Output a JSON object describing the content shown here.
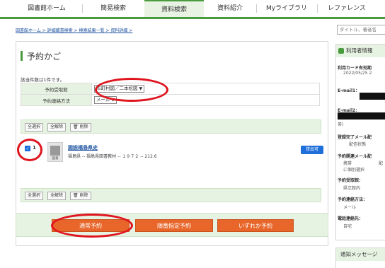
{
  "nav": {
    "tabs": [
      {
        "label": "図書館ホーム"
      },
      {
        "label": "簡易検索"
      },
      {
        "label": "資料検索"
      },
      {
        "label": "資料紹介"
      },
      {
        "label": "Myライブラリ"
      },
      {
        "label": "レファレンス"
      }
    ]
  },
  "breadcrumb": "図書館ホーム > 詳細蔵書検索 > 検索結果一覧 > 資料詳細 >",
  "search": {
    "placeholder": "タイトル、著者名"
  },
  "cart": {
    "title": "予約かご",
    "count_text": "該当件数は1件です。",
    "pickup_label": "予約受取館",
    "pickup_value": "市町村図／二本松図",
    "contact_label": "予約連絡方法",
    "contact_value": "メール",
    "select_all": "全選択",
    "deselect_all": "全解除",
    "delete": "削除",
    "item": {
      "number": "1",
      "title": "図説福島県史",
      "meta": "福島県 -- 福島県図書教材 -- １９７２ -- 212.6",
      "image_caption": "図書",
      "badge": "貸出可"
    }
  },
  "actions": {
    "normal": "通常予約",
    "ordered": "順番指定予約",
    "either": "いずれか予約"
  },
  "user_panel": {
    "title": "利用者情報",
    "card_expiry_label": "利用カード有効期",
    "card_expiry_value": "2022/05/25 2",
    "email1_label": "E-mail1：",
    "email2_label": "E-mail2：",
    "email2_note": "帯)",
    "reg_mail_label": "登録完了メール配",
    "reg_mail_value": "配信状態",
    "res_mail_label": "予約関連メール配",
    "res_mail_value1": "携帯",
    "res_mail_value1b": "配",
    "res_mail_value2": "に個別選択",
    "pickup_label": "予約受取館：",
    "pickup_value": "県立館内",
    "contact_label": "予約連絡方法：",
    "contact_value": "メール",
    "phone_label": "電話連絡先：",
    "phone_value": "自宅"
  },
  "notice": {
    "title": "通知メッセージ"
  },
  "colors": {
    "brand_green": "#4a9b3e",
    "accent_orange": "#e8662a",
    "highlight_red": "#e0141e",
    "link_blue": "#1a4fa0"
  }
}
